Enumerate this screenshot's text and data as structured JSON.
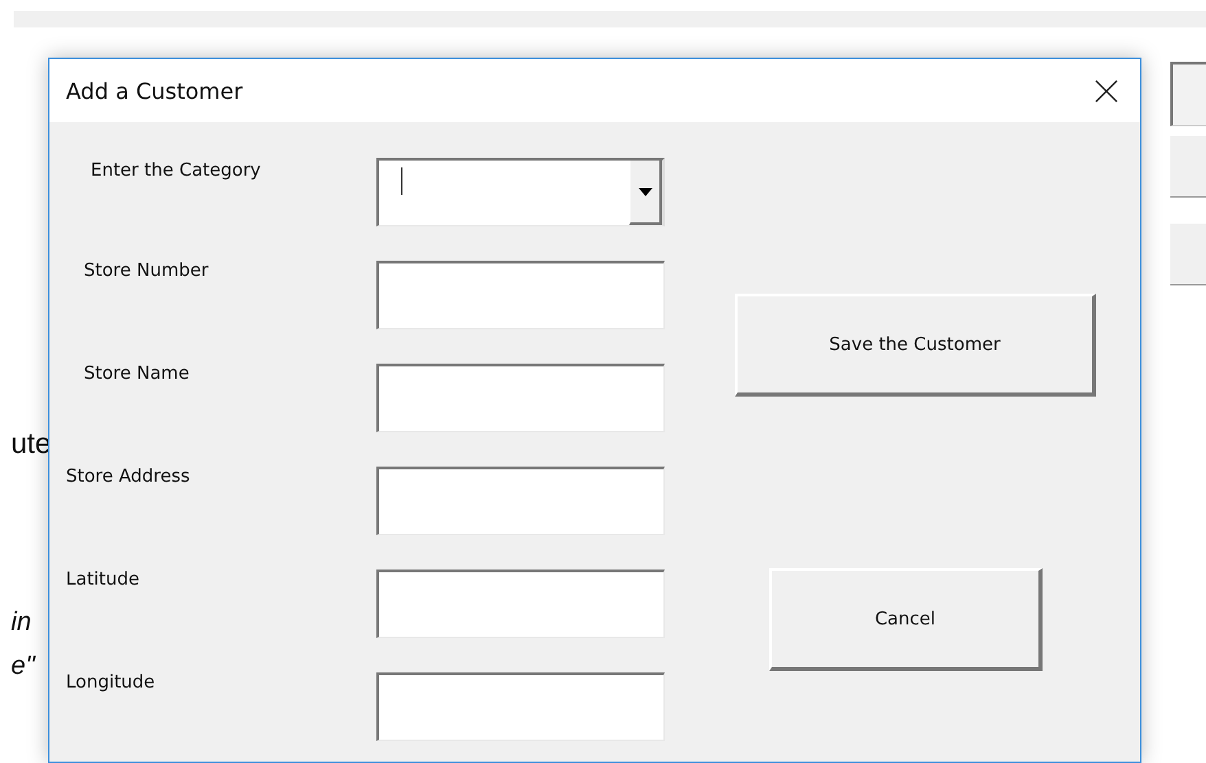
{
  "background": {
    "fragments": [
      {
        "text": "ute",
        "kind": "plain"
      },
      {
        "text": "in",
        "kind": "italic"
      },
      {
        "text": "e\"",
        "kind": "italic"
      }
    ]
  },
  "dialog": {
    "title": "Add a Customer",
    "fields": [
      {
        "label": "Enter the Category",
        "kind": "combo",
        "focused": true
      },
      {
        "label": "Store Number",
        "kind": "text",
        "focused": false
      },
      {
        "label": "Store Name",
        "kind": "text",
        "focused": false
      },
      {
        "label": "Store Address",
        "kind": "text",
        "focused": false
      },
      {
        "label": "Latitude",
        "kind": "text",
        "focused": false
      },
      {
        "label": "Longitude",
        "kind": "text",
        "focused": false
      }
    ],
    "buttons": [
      {
        "label": "Save the Customer",
        "kind": "save"
      },
      {
        "label": "Cancel",
        "kind": "cancel"
      }
    ]
  }
}
